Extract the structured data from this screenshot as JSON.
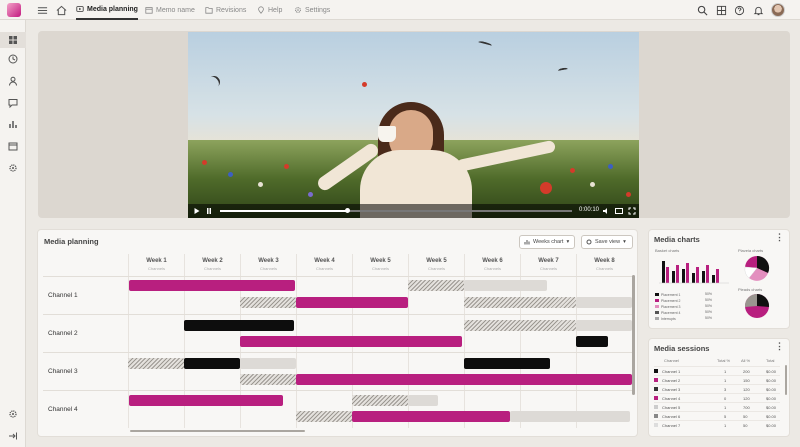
{
  "topnav": {
    "tabs": [
      {
        "label": "Media planning",
        "icon": "video-icon",
        "active": true
      },
      {
        "label": "Memo name",
        "icon": "calendar-icon",
        "active": false
      },
      {
        "label": "Revisions",
        "icon": "folder-icon",
        "active": false
      },
      {
        "label": "Help",
        "icon": "pin-icon",
        "active": false
      },
      {
        "label": "Settings",
        "icon": "gear-icon",
        "active": false
      }
    ]
  },
  "video": {
    "time": "0:00:10",
    "progress": 0.36
  },
  "planning": {
    "title": "Media planning",
    "view_button": "Weeks chart",
    "save_button": "Save view",
    "weeks": [
      {
        "name": "Week 1",
        "sub": "Channels"
      },
      {
        "name": "Week 2",
        "sub": "Channels"
      },
      {
        "name": "Week 3",
        "sub": "Channels"
      },
      {
        "name": "Week 4",
        "sub": "Channels"
      },
      {
        "name": "Week 5",
        "sub": "Channels"
      },
      {
        "name": "Week 5",
        "sub": "Channels"
      },
      {
        "name": "Week 6",
        "sub": "Channels"
      },
      {
        "name": "Week 7",
        "sub": "Channels"
      },
      {
        "name": "Week 8",
        "sub": "Channels"
      }
    ],
    "channels": [
      "Channel 1",
      "Channel 2",
      "Channel 3",
      "Channel 4"
    ]
  },
  "media_charts": {
    "title": "Media charts",
    "bar_label": "Basket charts",
    "pie_label": "Plaveia charts",
    "pie_label2": "Pleads charts",
    "legend": [
      {
        "label": "Placement 1",
        "pct": "50%",
        "color": "#111111"
      },
      {
        "label": "Placement 2",
        "pct": "50%",
        "color": "#b81f7f"
      },
      {
        "label": "Placement 3",
        "pct": "50%",
        "color": "#e38fbf"
      },
      {
        "label": "Placement 4",
        "pct": "50%",
        "color": "#555555"
      },
      {
        "label": "Interrupts",
        "pct": "50%",
        "color": "#aaaaaa"
      }
    ]
  },
  "media_sessions": {
    "title": "Media sessions",
    "headers": [
      "Channel",
      "Total %",
      "All %",
      "Total"
    ],
    "rows": [
      {
        "channel": "Channel 1",
        "a": "1",
        "b": "200",
        "c": "$0.00",
        "color": "#111111"
      },
      {
        "channel": "Channel 2",
        "a": "1",
        "b": "150",
        "c": "$0.00",
        "color": "#b81f7f"
      },
      {
        "channel": "Channel 3",
        "a": "3",
        "b": "120",
        "c": "$0.00",
        "color": "#333333"
      },
      {
        "channel": "Channel 4",
        "a": "0",
        "b": "120",
        "c": "$0.00",
        "color": "#b81f7f"
      },
      {
        "channel": "Channel 5",
        "a": "1",
        "b": "700",
        "c": "$0.00",
        "color": "#cccccc"
      },
      {
        "channel": "Channel 6",
        "a": "5",
        "b": "50",
        "c": "$0.00",
        "color": "#888888"
      },
      {
        "channel": "Channel 7",
        "a": "1",
        "b": "50",
        "c": "$0.00",
        "color": "#dddddd"
      }
    ]
  },
  "colors": {
    "accent": "#b81f7f",
    "dark": "#0d0d0d",
    "neutral": "#dddad6"
  }
}
